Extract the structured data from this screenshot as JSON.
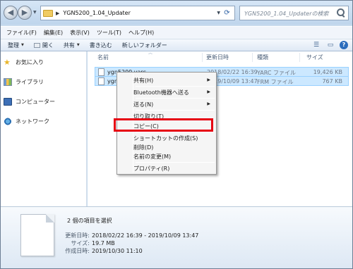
{
  "address_bar": {
    "path_segment": "YGN5200_1.04_Updater",
    "search_placeholder": "YGN5200_1.04_Updaterの検索"
  },
  "menu": [
    "ファイル(F)",
    "編集(E)",
    "表示(V)",
    "ツール(T)",
    "ヘルプ(H)"
  ],
  "toolbar": {
    "organize": "整理",
    "open": "開く",
    "share": "共有",
    "burn": "書き込む",
    "new_folder": "新しいフォルダー"
  },
  "nav": {
    "favorites": "お気に入り",
    "libraries": "ライブラリ",
    "computer": "コンピューター",
    "network": "ネットワーク"
  },
  "columns": {
    "name": "名前",
    "date": "更新日時",
    "type": "種類",
    "size": "サイズ"
  },
  "files": [
    {
      "name": "ygn5200.yarc",
      "date": "2018/02/22 16:39",
      "type": "YARC ファイル",
      "size": "19,426 KB"
    },
    {
      "name": "ygn5",
      "date": "2019/10/09 13:47",
      "type": "FRM ファイル",
      "size": "767 KB"
    }
  ],
  "context_menu": {
    "share": "共有(H)",
    "bluetooth": "Bluetooth機器へ送る",
    "send_to": "送る(N)",
    "cut": "切り取り(T)",
    "copy": "コピー(C)",
    "shortcut": "ショートカットの作成(S)",
    "delete": "削除(D)",
    "rename": "名前の変更(M)",
    "properties": "プロパティ(R)"
  },
  "details": {
    "selection": "2 個の項目を選択",
    "modified_label": "更新日時:",
    "modified_value": "2018/02/22 16:39 - 2019/10/09 13:47",
    "size_label": "サイズ:",
    "size_value": "19.7 MB",
    "created_label": "作成日時:",
    "created_value": "2019/10/30 11:10"
  },
  "colors": {
    "selection_fill": "#cce8ff",
    "highlight_box": "#e60012"
  }
}
